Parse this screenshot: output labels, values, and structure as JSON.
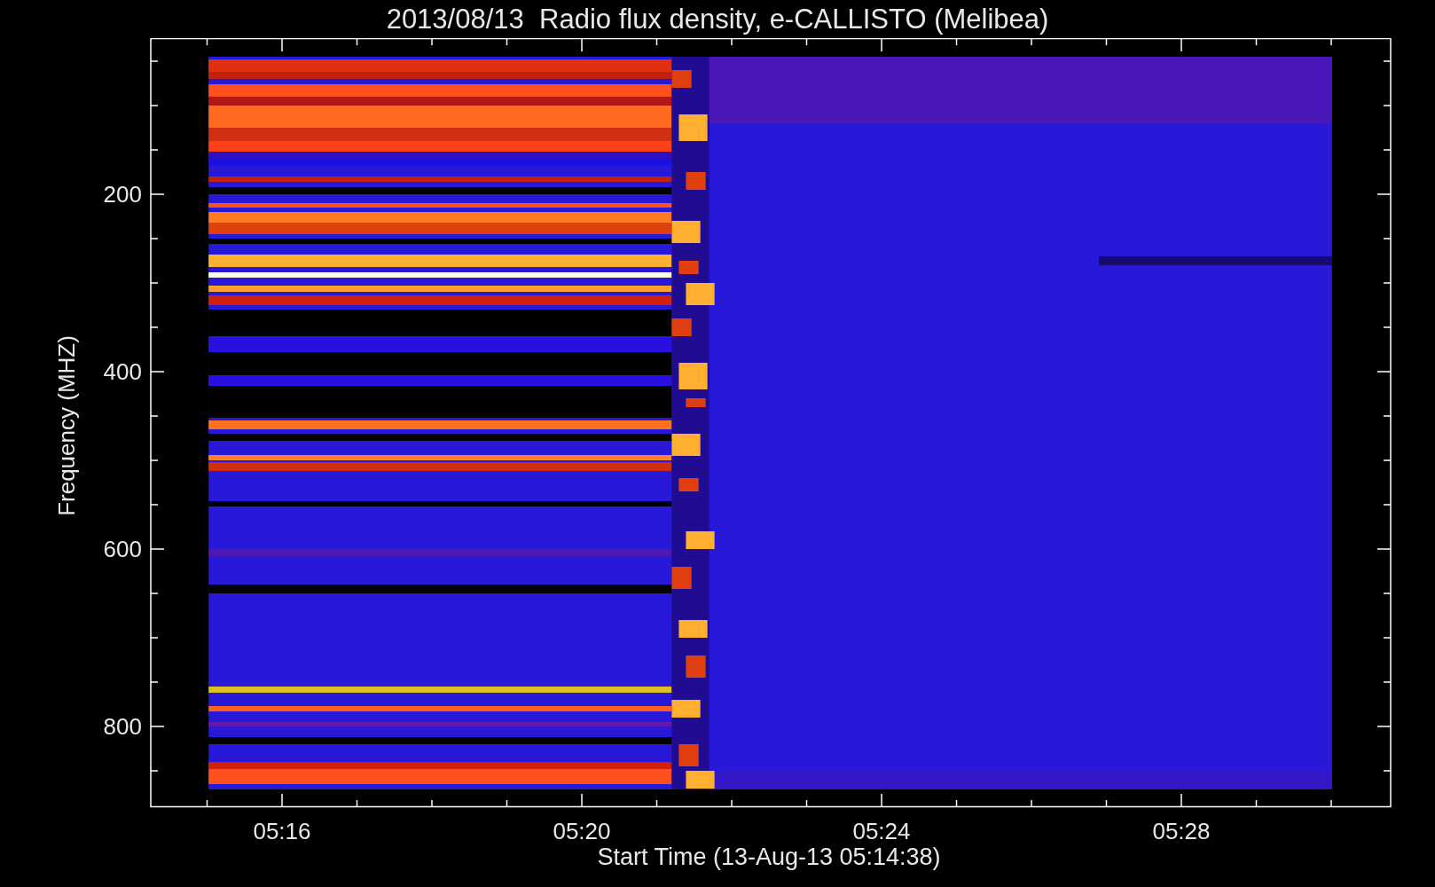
{
  "title": "2013/08/13  Radio flux density, e-CALLISTO (Melibea)",
  "y_axis": {
    "label": "Frequency (MHZ)",
    "ticks": [
      "200",
      "400",
      "600",
      "800"
    ]
  },
  "x_axis": {
    "label": "Start Time (13-Aug-13 05:14:38)",
    "ticks": [
      "05:16",
      "05:20",
      "05:24",
      "05:28"
    ]
  }
}
